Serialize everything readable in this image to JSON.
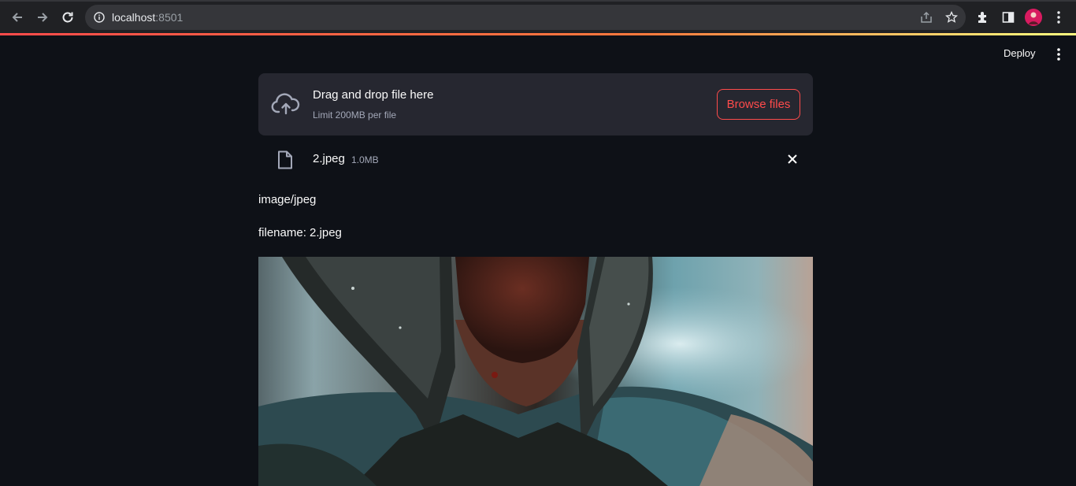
{
  "browser": {
    "url_host": "localhost",
    "url_port": ":8501"
  },
  "header": {
    "deploy_label": "Deploy"
  },
  "uploader": {
    "drop_title": "Drag and drop file here",
    "drop_limit": "Limit 200MB per file",
    "browse_label": "Browse files",
    "file": {
      "name": "2.jpeg",
      "size": "1.0MB"
    }
  },
  "content": {
    "mime_text": "image/jpeg",
    "filename_text": "filename: 2.jpeg"
  },
  "colors": {
    "accent": "#ff4b4b",
    "background": "#0e1117",
    "panel": "#262730"
  }
}
